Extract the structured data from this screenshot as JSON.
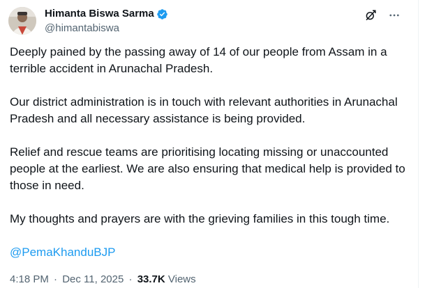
{
  "author": {
    "display_name": "Himanta Biswa Sarma",
    "handle": "@himantabiswa",
    "verified": true,
    "verified_color": "#1d9bf0"
  },
  "actions": {
    "grok_icon": "grok-icon",
    "more_icon": "more-icon"
  },
  "post": {
    "paragraphs": [
      "Deeply pained by the passing away of 14 of our people from Assam in a terrible accident in Arunachal Pradesh.",
      "Our district administration is in touch with relevant authorities in Arunachal Pradesh and all necessary assistance is being provided.",
      "Relief and rescue teams are prioritising locating missing or unaccounted people at the earliest. We are also ensuring that medical help is provided to those in need.",
      "My thoughts and prayers are with the grieving families in this tough time."
    ],
    "mention": "@PemaKhanduBJP",
    "mention_color": "#1d9bf0"
  },
  "meta": {
    "time": "4:18 PM",
    "separator": "·",
    "date": "Dec 11, 2025",
    "views_count": "33.7K",
    "views_label": "Views"
  }
}
